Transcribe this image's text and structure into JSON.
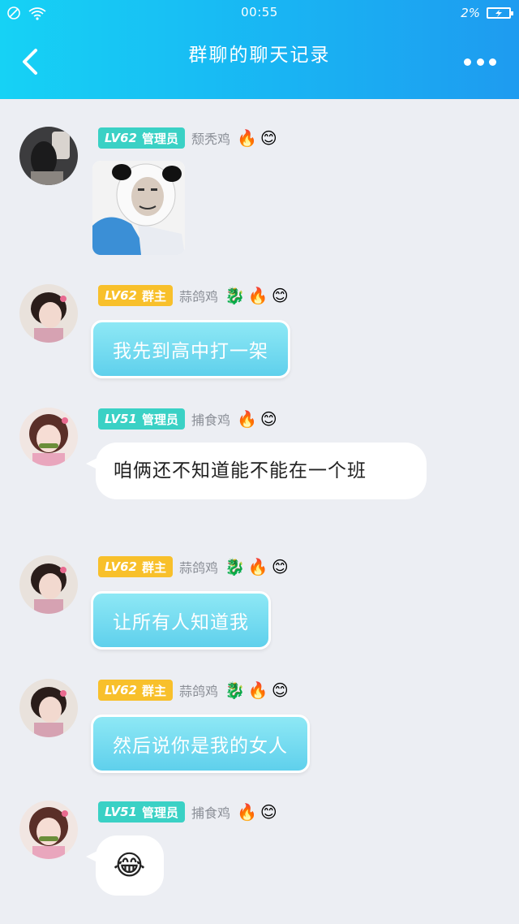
{
  "status": {
    "time": "00:55",
    "battery": "2%"
  },
  "header": {
    "title": "群聊的聊天记录"
  },
  "colors": {
    "header_start": "#16d2f5",
    "header_end": "#1e9bf0",
    "admin_badge": "#3ad1c5",
    "owner_badge": "#f8c02b",
    "blue_bubble": "#5fd0ec"
  },
  "messages": [
    {
      "level": "LV62",
      "role": "管理员",
      "name": "颓秃鸡",
      "icons": [
        "fire-icon",
        "flower-smile-icon"
      ],
      "content_type": "sticker",
      "sticker": "panda-face-meme"
    },
    {
      "level": "LV62",
      "role": "群主",
      "name": "蒜鸽鸡",
      "icons": [
        "dragon-icon",
        "fire-icon",
        "flower-smile-icon"
      ],
      "content_type": "text",
      "text": "我先到高中打一架"
    },
    {
      "level": "LV51",
      "role": "管理员",
      "name": "捕食鸡",
      "icons": [
        "fire-icon",
        "flower-smile-icon"
      ],
      "content_type": "text",
      "text": "咱俩还不知道能不能在一个班"
    },
    {
      "level": "LV62",
      "role": "群主",
      "name": "蒜鸽鸡",
      "icons": [
        "dragon-icon",
        "fire-icon",
        "flower-smile-icon"
      ],
      "content_type": "text",
      "text": "让所有人知道我"
    },
    {
      "level": "LV62",
      "role": "群主",
      "name": "蒜鸽鸡",
      "icons": [
        "dragon-icon",
        "fire-icon",
        "flower-smile-icon"
      ],
      "content_type": "text",
      "text": "然后说你是我的女人"
    },
    {
      "level": "LV51",
      "role": "管理员",
      "name": "捕食鸡",
      "icons": [
        "fire-icon",
        "flower-smile-icon"
      ],
      "content_type": "emoji",
      "text": "😂"
    }
  ]
}
